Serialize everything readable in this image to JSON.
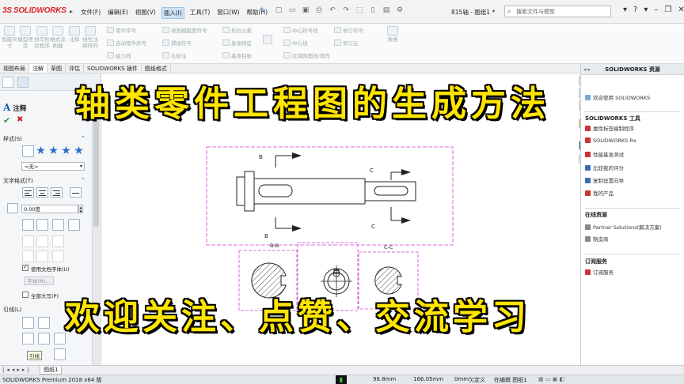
{
  "app": {
    "logo_prefix": "3S",
    "logo_name": "SOLIDWORKS",
    "document_title": "815轴 - 图纸1 *"
  },
  "menu": {
    "items": [
      "文件(F)",
      "编辑(E)",
      "视图(V)",
      "插入(I)",
      "工具(T)",
      "窗口(W)",
      "帮助(H)"
    ],
    "active_index": 3
  },
  "search": {
    "placeholder": "搜索文件与模型"
  },
  "ribbon": {
    "big_buttons": [
      "智能尺寸",
      "模型项目",
      "拼写检验程序",
      "格式涂刷器",
      "注释",
      "线性注释阵列"
    ],
    "small_items": [
      "零件序号",
      "自动零件序号",
      "磁力线",
      "表面粗糙度符号",
      "焊接符号",
      "孔标注",
      "形位公差",
      "基准特征",
      "基准目标",
      "中心符号线",
      "中心线",
      "区域剖面线/填充",
      "修订符号",
      "修订云",
      "表格"
    ]
  },
  "tabs": {
    "items": [
      "视图布局",
      "注解",
      "草图",
      "评估",
      "SOLIDWORKS 插件",
      "图纸格式"
    ],
    "active_index": 1
  },
  "property_manager": {
    "title": "注释",
    "style_section": "样式(S)",
    "style_select": "<无>",
    "text_format_section": "文字格式(T)",
    "angle_value": "0.00度",
    "use_doc_font_label": "使用文档字体(U)",
    "use_doc_font_checked": true,
    "font_button": "字体(N)...",
    "all_caps_label": "全部大写(P)",
    "all_caps_checked": false,
    "leader_section": "引线(L)",
    "tooltip": "引线"
  },
  "drawing": {
    "section_letter_b": "B",
    "section_letter_c": "C",
    "view_label_bb": "B-B",
    "view_label_cc": "C-C"
  },
  "task_pane": {
    "title": "SOLIDWORKS 资源",
    "welcome": "欢迎使用 SOLIDWORKS",
    "tools_header": "SOLIDWORKS 工具",
    "tools": [
      "属性标签编制程序",
      "SOLIDWORKS Rx",
      "性能基准测试",
      "比较我的评分",
      "复制设置向导",
      "我的产品"
    ],
    "online_header": "在线资源",
    "online": [
      "Partner Solutions(解决方案)",
      "制造商"
    ],
    "subscription_header": "订阅服务",
    "subscription": [
      "订阅服务"
    ]
  },
  "sheet_tab": "图纸1",
  "status": {
    "version": "SOLIDWORKS Premium 2018 x64 版",
    "x": "98.8mm",
    "y": "166.05mm",
    "z": "0mm",
    "state": "欠定义",
    "editing": "在编辑 图纸1"
  },
  "overlay": {
    "title": "轴类零件工程图的生成方法",
    "footer": "欢迎关注、点赞、交流学习"
  },
  "colors": {
    "caption": "#ffe500",
    "sheet_border": "#d040d0",
    "accent": "#2b6ec7"
  }
}
